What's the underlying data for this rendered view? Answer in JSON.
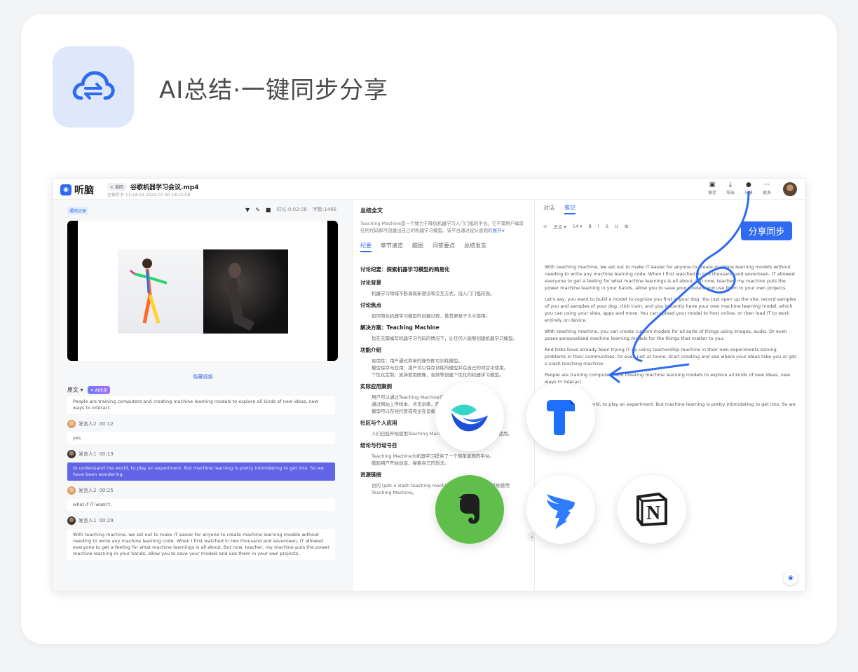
{
  "hero": {
    "title": "AI总结·一键同步分享"
  },
  "app": {
    "logo": "听脑",
    "back": "< 返回",
    "file_name": "谷歌机器学习会议.mp4",
    "file_meta": "已保存于 11:24:23    2024-07-30 18:22:08",
    "actions": [
      {
        "label": "保存",
        "icon": "save-icon"
      },
      {
        "label": "导出",
        "icon": "download-icon"
      },
      {
        "label": "分享",
        "icon": "share-icon"
      },
      {
        "label": "更多",
        "icon": "more-icon"
      }
    ]
  },
  "left": {
    "tag": "通用记录",
    "duration": "时长:0:02:08",
    "word_count": "字数:1466",
    "hide_video": "隐藏视频",
    "lang": "原文 ▾",
    "ai_badge": "✦ AI优化",
    "transcript": [
      {
        "text": "People are training computers and creating machine learning models to explore all kinds of new ideas, new ways to interact."
      },
      {
        "speaker": "发言人2",
        "time": "00:12",
        "text": "yes"
      },
      {
        "speaker": "发言人1",
        "time": "00:13",
        "text": "to understand the world, to play an experiment. But machine learning is pretty intimidating to get into. So we have been wondering."
      },
      {
        "speaker": "发言人2",
        "time": "00:25",
        "text": "what if IT wasn't."
      },
      {
        "speaker": "发言人1",
        "time": "00:29",
        "text": "With teaching machine, we set out to make IT easier for anyone to create machine learning models without needing to write any machine learning code. When I first watched in two thousand and seventeen, IT allowed everyone to get a feeling for what machine learnings is all about. But now, teacher, my machine puts the power machine learning in your hands, allow you to save your models and use them in your own projects."
      }
    ]
  },
  "mid": {
    "heading": "总结全文",
    "summary": "Teaching Machine是一个致力于降低机器学习入门门槛的平台。它不需用户编写任何代码即可创建出自己的机器学习模型。该平台通过设计直观的",
    "expand": "展开∨",
    "tabs": [
      "纪要",
      "章节速览",
      "脑图",
      "问答要点",
      "总结发言"
    ],
    "title": "讨论纪要：探索机器学习模型的简易化",
    "sections": [
      {
        "h": "讨论背景",
        "p": "机器学习领域不断涌现新想法和交互方式，但入门门槛较高。"
      },
      {
        "h": "讨论焦点",
        "p": "如何简化机器学习模型的创建过程，使其更易于大众使用。"
      },
      {
        "h": "解决方案：Teaching Machine",
        "p": "旨在无需编写机器学习代码的情况下，让任何人能够创建机器学习模型。"
      },
      {
        "h": "功能介绍",
        "lines": [
          "易用性：用户通过简单的操作即可训练模型。",
          "模型保存与应用：用户可以保存训练的模型并在自己的项目中使用。",
          "个性化定制：支持使用图像、音频等创建个性化的机器学习模型。"
        ]
      },
      {
        "h": "实际应用案例",
        "lines": [
          "用户可以通过Teaching Machine识别图像、声音等信息。",
          "通过网站上传样本，点击训练，即可获得自己的模型。",
          "模型可以在线托管或完全在设备上运行。"
        ]
      },
      {
        "h": "社区与个人应用",
        "p": "人们已经开始使用Teaching Machine解决社区问题、或在家中使用。"
      },
      {
        "h": "结论与行动号召",
        "lines": [
          "Teaching Machine为机器学习提供了一个简单直观的平台。",
          "鼓励用户开始创造，探索自己的想法。"
        ]
      },
      {
        "h": "资源链接",
        "p": "访问 [gdc o slash teaching machine] 以了解更多信息和开始使用 Teaching Machine。"
      }
    ]
  },
  "right": {
    "tabs": [
      "对话",
      "笔记"
    ],
    "toolbar": [
      "⊙",
      "正文 ▾",
      "14 ▾",
      "B",
      "I",
      "S",
      "U",
      "⊞"
    ],
    "share_btn": "分享同步",
    "notes": [
      "With teaching machine, we set out to make IT easier for anyone to create machine learning models without needing to write any machine learning code. When I first watched in two thousand and seventeen, IT allowed everyone to get a feeling for what machine learnings is all about. But now, teacher, my machine puts the power machine learning in your hands, allow you to save your models and use them in your own projects.",
      "Let's say, you want to build a model to cognize you first is your dog. You just open up the site, record samples of you and samples of your dog, click train, and you instantly have your own machine learning model, which you can using your sites, apps and more. You can upload your model to host online, or then load IT to work entirely on device.",
      "With teaching machine, you can create custom models for all sorts of things using images, audio. Or even poses personalized machine learning models for the things that matter to you.",
      "And folks have already been trying IT up using teachership machine in their own experiments solving problems in their communities. Or even just at home. Start creating and see where your ideas take you at gdc o slash teaching machine.",
      "People are training computers and creating machine learning models to explore all kinds of new ideas, new ways to interact.",
      "yes.",
      "to understand the world, to play an experiment. But machine learning is pretty intimidating to get into. So we have"
    ]
  },
  "share_targets": [
    "feishu-icon",
    "tencent-docs-icon",
    "evernote-icon",
    "dingtalk-icon",
    "notion-icon"
  ],
  "colors": {
    "accent": "#2f6bf0",
    "highlight": "#6264e6",
    "evernote": "#5fbf4a"
  }
}
